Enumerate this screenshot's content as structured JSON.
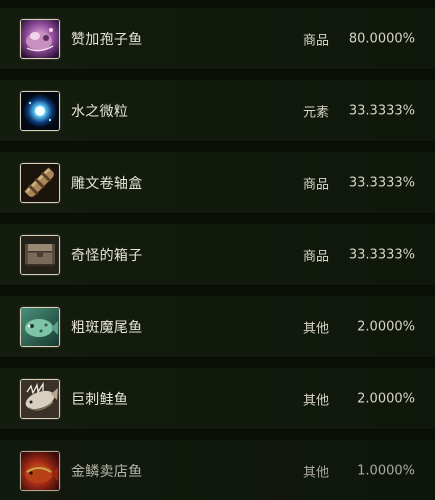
{
  "loot_table": {
    "items": [
      {
        "name": "赞加孢子鱼",
        "type": "商品",
        "rate": "80.0000%",
        "icon": "zangar-spore-fish-icon"
      },
      {
        "name": "水之微粒",
        "type": "元素",
        "rate": "33.3333%",
        "icon": "mote-of-water-icon"
      },
      {
        "name": "雕文卷轴盒",
        "type": "商品",
        "rate": "33.3333%",
        "icon": "scroll-case-icon"
      },
      {
        "name": "奇怪的箱子",
        "type": "商品",
        "rate": "33.3333%",
        "icon": "strange-chest-icon"
      },
      {
        "name": "粗斑魔尾鱼",
        "type": "其他",
        "rate": "2.0000%",
        "icon": "spotted-feltail-icon"
      },
      {
        "name": "巨刺鲑鱼",
        "type": "其他",
        "rate": "2.0000%",
        "icon": "barbed-salmon-icon"
      },
      {
        "name": "金鳞卖店鱼",
        "type": "其他",
        "rate": "1.0000%",
        "icon": "golden-scale-fish-icon"
      }
    ]
  },
  "colors": {
    "background": "#0b0f08",
    "row": "#141c10",
    "text": "#e8e4d8",
    "icon_border": "#d9d2b8"
  }
}
